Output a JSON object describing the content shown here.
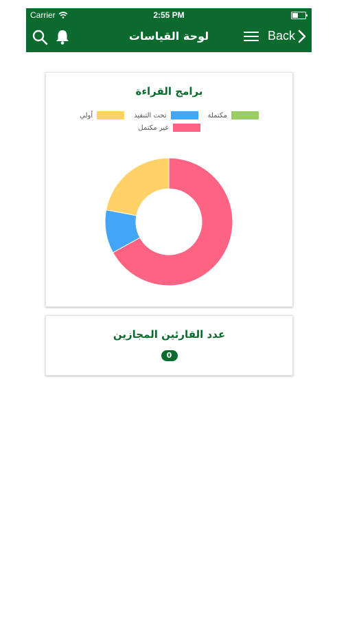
{
  "status_bar": {
    "carrier": "Carrier",
    "time": "2:55 PM"
  },
  "nav": {
    "title": "لوحة القياسات",
    "back_label": "Back",
    "color": "#0b6b2e"
  },
  "reading_card": {
    "title": "برامج القراءة",
    "legend": [
      {
        "label": "مكتملة",
        "color": "#9ccc65"
      },
      {
        "label": "تحت التنفيذ",
        "color": "#42a5f5"
      },
      {
        "label": "أولي",
        "color": "#ffd166"
      },
      {
        "label": "غير مكتمل",
        "color": "#ff6384"
      }
    ]
  },
  "chart_data": {
    "type": "pie",
    "categories": [
      "مكتملة",
      "تحت التنفيذ",
      "أولي",
      "غير مكتمل"
    ],
    "values": [
      0,
      11,
      22,
      67
    ],
    "colors": [
      "#9ccc65",
      "#42a5f5",
      "#ffd166",
      "#ff6384"
    ],
    "donut": true,
    "title": "برامج القراءة"
  },
  "readers_card": {
    "title": "عدد القارئين المجازين",
    "count": "0"
  }
}
